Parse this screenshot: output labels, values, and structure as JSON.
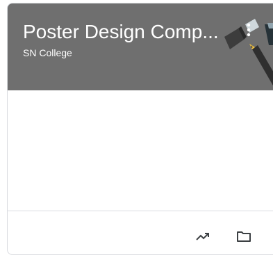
{
  "card": {
    "title": "Poster Design Comp...",
    "subtitle": "SN College"
  },
  "icons": {
    "more": "more-vert-icon",
    "trend": "trending-up-icon",
    "folder": "folder-icon"
  },
  "colors": {
    "header_bg": "#6f6f6f",
    "text_on_header": "#ffffff",
    "footer_icon": "#3c4043"
  }
}
